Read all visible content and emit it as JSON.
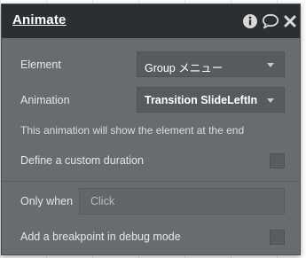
{
  "panel": {
    "title": "Animate"
  },
  "header_icons": [
    "info-icon",
    "comment-icon",
    "close-icon"
  ],
  "fields": {
    "element_label": "Element",
    "element_value": "Group メニュー",
    "animation_label": "Animation",
    "animation_value": "Transition SlideLeftIn",
    "info_text": "This animation will show the element at the end",
    "custom_duration_label": "Define a custom duration",
    "custom_duration_checked": false,
    "only_when_label": "Only when",
    "only_when_placeholder": "Click",
    "breakpoint_label": "Add a breakpoint in debug mode",
    "breakpoint_checked": false
  },
  "colors": {
    "header_bg": "#2b2f33",
    "panel_bg": "#696c6f",
    "field_bg": "#585b5e",
    "text": "#e6e6e6"
  }
}
